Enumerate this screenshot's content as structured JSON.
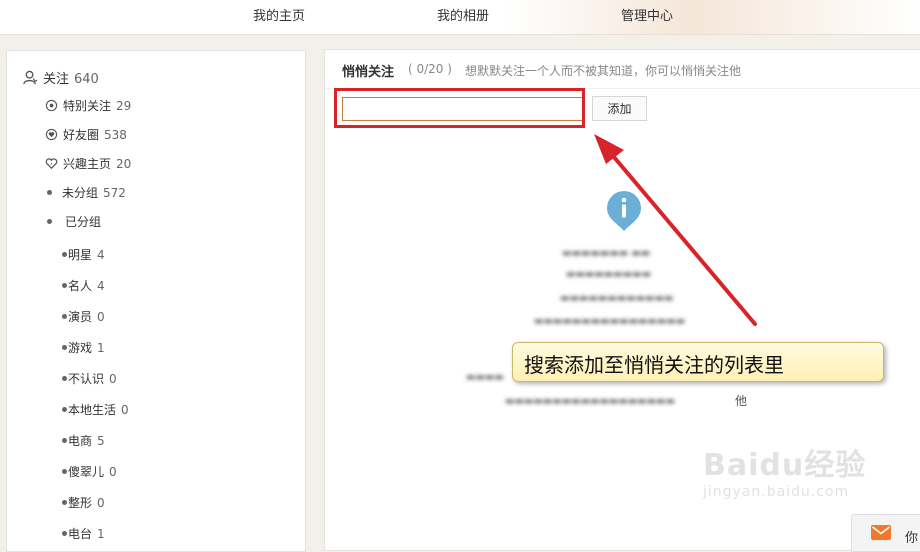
{
  "nav": {
    "home": "我的主页",
    "album": "我的相册",
    "admin": "管理中心"
  },
  "sidebar": {
    "follow": {
      "label": "关注",
      "count": "640"
    },
    "groups": [
      {
        "label": "特别关注",
        "count": "29",
        "icon": "eye-icon"
      },
      {
        "label": "好友圈",
        "count": "538",
        "icon": "heart-circle-icon"
      },
      {
        "label": "兴趣主页",
        "count": "20",
        "icon": "heart-outline-icon"
      },
      {
        "label": "未分组",
        "count": "572",
        "icon": "dot-icon"
      },
      {
        "label": "已分组",
        "count": "",
        "icon": "dot-icon"
      }
    ],
    "subgroups": [
      {
        "label": "明星",
        "count": "4"
      },
      {
        "label": "名人",
        "count": "4"
      },
      {
        "label": "演员",
        "count": "0"
      },
      {
        "label": "游戏",
        "count": "1"
      },
      {
        "label": "不认识",
        "count": "0"
      },
      {
        "label": "本地生活",
        "count": "0"
      },
      {
        "label": "电商",
        "count": "5"
      },
      {
        "label": "傻翠儿",
        "count": "0"
      },
      {
        "label": "整形",
        "count": "0"
      },
      {
        "label": "电台",
        "count": "1"
      }
    ]
  },
  "main": {
    "title": "悄悄关注",
    "quota": "( 0/20 )",
    "description": "想默默关注一个人而不被其知道，你可以悄悄关注他",
    "search_value": "",
    "add_label": "添加",
    "trailing_text": "他"
  },
  "annotation": {
    "callout_text": "搜索添加至悄悄关注的列表里",
    "highlight_color": "#d9232a"
  },
  "watermark": {
    "logo": "Baidu经验",
    "url": "jingyan.baidu.com"
  },
  "message_tab": {
    "label": "你"
  },
  "colors": {
    "accent_orange": "#c87f3c",
    "info_blue": "#6baed6",
    "annotation_red": "#d9232a"
  }
}
